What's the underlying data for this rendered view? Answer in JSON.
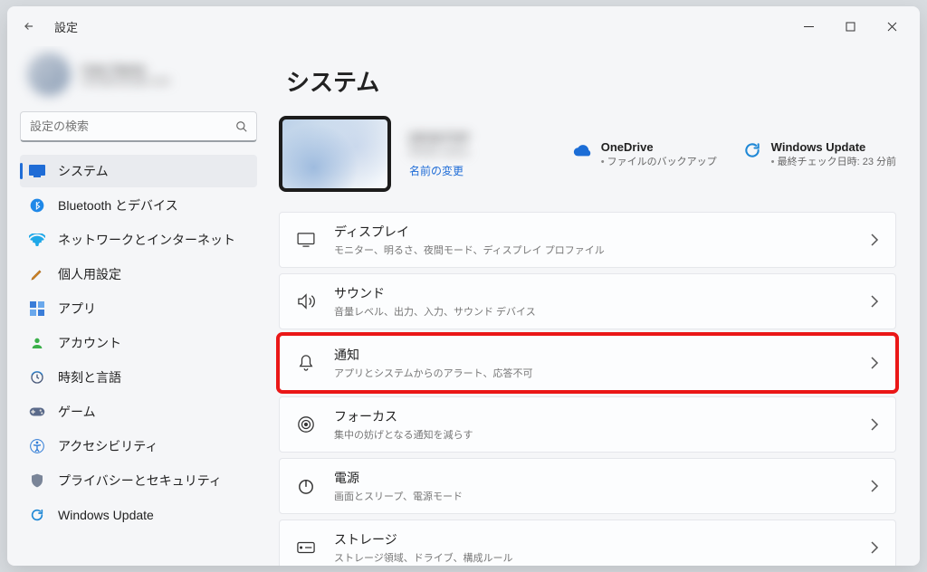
{
  "window": {
    "title": "設定"
  },
  "search": {
    "placeholder": "設定の検索"
  },
  "sidebar": {
    "items": [
      {
        "label": "システム"
      },
      {
        "label": "Bluetooth とデバイス"
      },
      {
        "label": "ネットワークとインターネット"
      },
      {
        "label": "個人用設定"
      },
      {
        "label": "アプリ"
      },
      {
        "label": "アカウント"
      },
      {
        "label": "時刻と言語"
      },
      {
        "label": "ゲーム"
      },
      {
        "label": "アクセシビリティ"
      },
      {
        "label": "プライバシーとセキュリティ"
      },
      {
        "label": "Windows Update"
      }
    ]
  },
  "page": {
    "title": "システム",
    "device": {
      "name": "DESKTOP",
      "model": "Model name",
      "rename": "名前の変更"
    },
    "hero": {
      "onedrive": {
        "title": "OneDrive",
        "sub": "ファイルのバックアップ"
      },
      "update": {
        "title": "Windows Update",
        "sub": "最終チェック日時: 23 分前"
      }
    },
    "cards": [
      {
        "title": "ディスプレイ",
        "desc": "モニター、明るさ、夜間モード、ディスプレイ プロファイル"
      },
      {
        "title": "サウンド",
        "desc": "音量レベル、出力、入力、サウンド デバイス"
      },
      {
        "title": "通知",
        "desc": "アプリとシステムからのアラート、応答不可"
      },
      {
        "title": "フォーカス",
        "desc": "集中の妨げとなる通知を減らす"
      },
      {
        "title": "電源",
        "desc": "画面とスリープ、電源モード"
      },
      {
        "title": "ストレージ",
        "desc": "ストレージ領域、ドライブ、構成ルール"
      }
    ]
  }
}
